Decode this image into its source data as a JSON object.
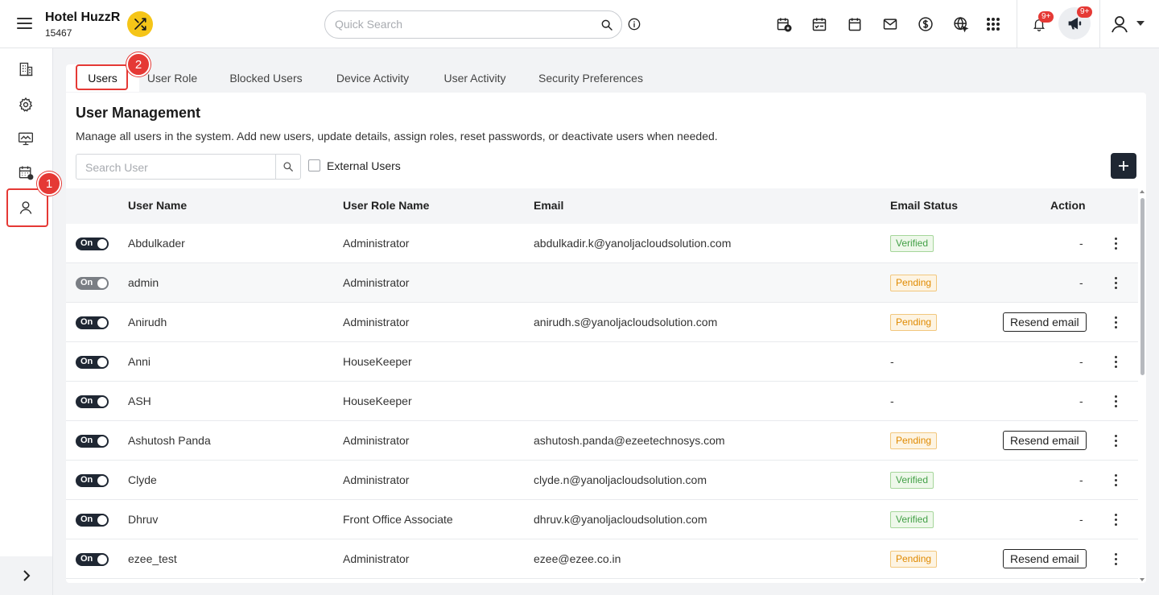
{
  "header": {
    "hotel_name": "Hotel HuzzR",
    "hotel_id": "15467",
    "search_placeholder": "Quick Search",
    "notification_badge": "9+",
    "announcement_badge": "9+",
    "icons": [
      "calendar-add-icon",
      "calendar-check-icon",
      "calendar-icon",
      "mail-icon",
      "dollar-icon",
      "globe-icon",
      "apps-grid-icon",
      "bell-icon",
      "megaphone-icon",
      "user-icon"
    ]
  },
  "sidebar": {
    "items": [
      "building-icon",
      "gear-icon",
      "monitor-icon",
      "calendar-grid-icon",
      "user-icon"
    ],
    "active": "user-icon"
  },
  "steps": {
    "one": "1",
    "two": "2"
  },
  "tabs": [
    {
      "label": "Users",
      "active": true
    },
    {
      "label": "User Role"
    },
    {
      "label": "Blocked Users"
    },
    {
      "label": "Device Activity"
    },
    {
      "label": "User Activity"
    },
    {
      "label": "Security Preferences"
    }
  ],
  "panel": {
    "title": "User Management",
    "subtitle": "Manage all users in the system. Add new users, update details, assign roles, reset passwords, or deactivate users when needed.",
    "search_placeholder": "Search User",
    "external_users_label": "External Users"
  },
  "table": {
    "headers": {
      "user_name": "User Name",
      "role": "User Role Name",
      "email": "Email",
      "email_status": "Email Status",
      "action": "Action"
    },
    "rows": [
      {
        "toggle": "On",
        "name": "Abdulkader",
        "role": "Administrator",
        "email": "abdulkadir.k@yanoljacloudsolution.com",
        "status": "Verified",
        "action": "-"
      },
      {
        "toggle": "On",
        "name": "admin",
        "role": "Administrator",
        "email": "",
        "status": "Pending",
        "action": "-"
      },
      {
        "toggle": "On",
        "name": "Anirudh",
        "role": "Administrator",
        "email": "anirudh.s@yanoljacloudsolution.com",
        "status": "Pending",
        "action": "Resend email"
      },
      {
        "toggle": "On",
        "name": "Anni",
        "role": "HouseKeeper",
        "email": "",
        "status": "-",
        "action": "-"
      },
      {
        "toggle": "On",
        "name": "ASH",
        "role": "HouseKeeper",
        "email": "",
        "status": "-",
        "action": "-"
      },
      {
        "toggle": "On",
        "name": "Ashutosh Panda",
        "role": "Administrator",
        "email": "ashutosh.panda@ezeetechnosys.com",
        "status": "Pending",
        "action": "Resend email"
      },
      {
        "toggle": "On",
        "name": "Clyde",
        "role": "Administrator",
        "email": "clyde.n@yanoljacloudsolution.com",
        "status": "Verified",
        "action": "-"
      },
      {
        "toggle": "On",
        "name": "Dhruv",
        "role": "Front Office Associate",
        "email": "dhruv.k@yanoljacloudsolution.com",
        "status": "Verified",
        "action": "-"
      },
      {
        "toggle": "On",
        "name": "ezee_test",
        "role": "Administrator",
        "email": "ezee@ezee.co.in",
        "status": "Pending",
        "action": "Resend email"
      }
    ]
  }
}
